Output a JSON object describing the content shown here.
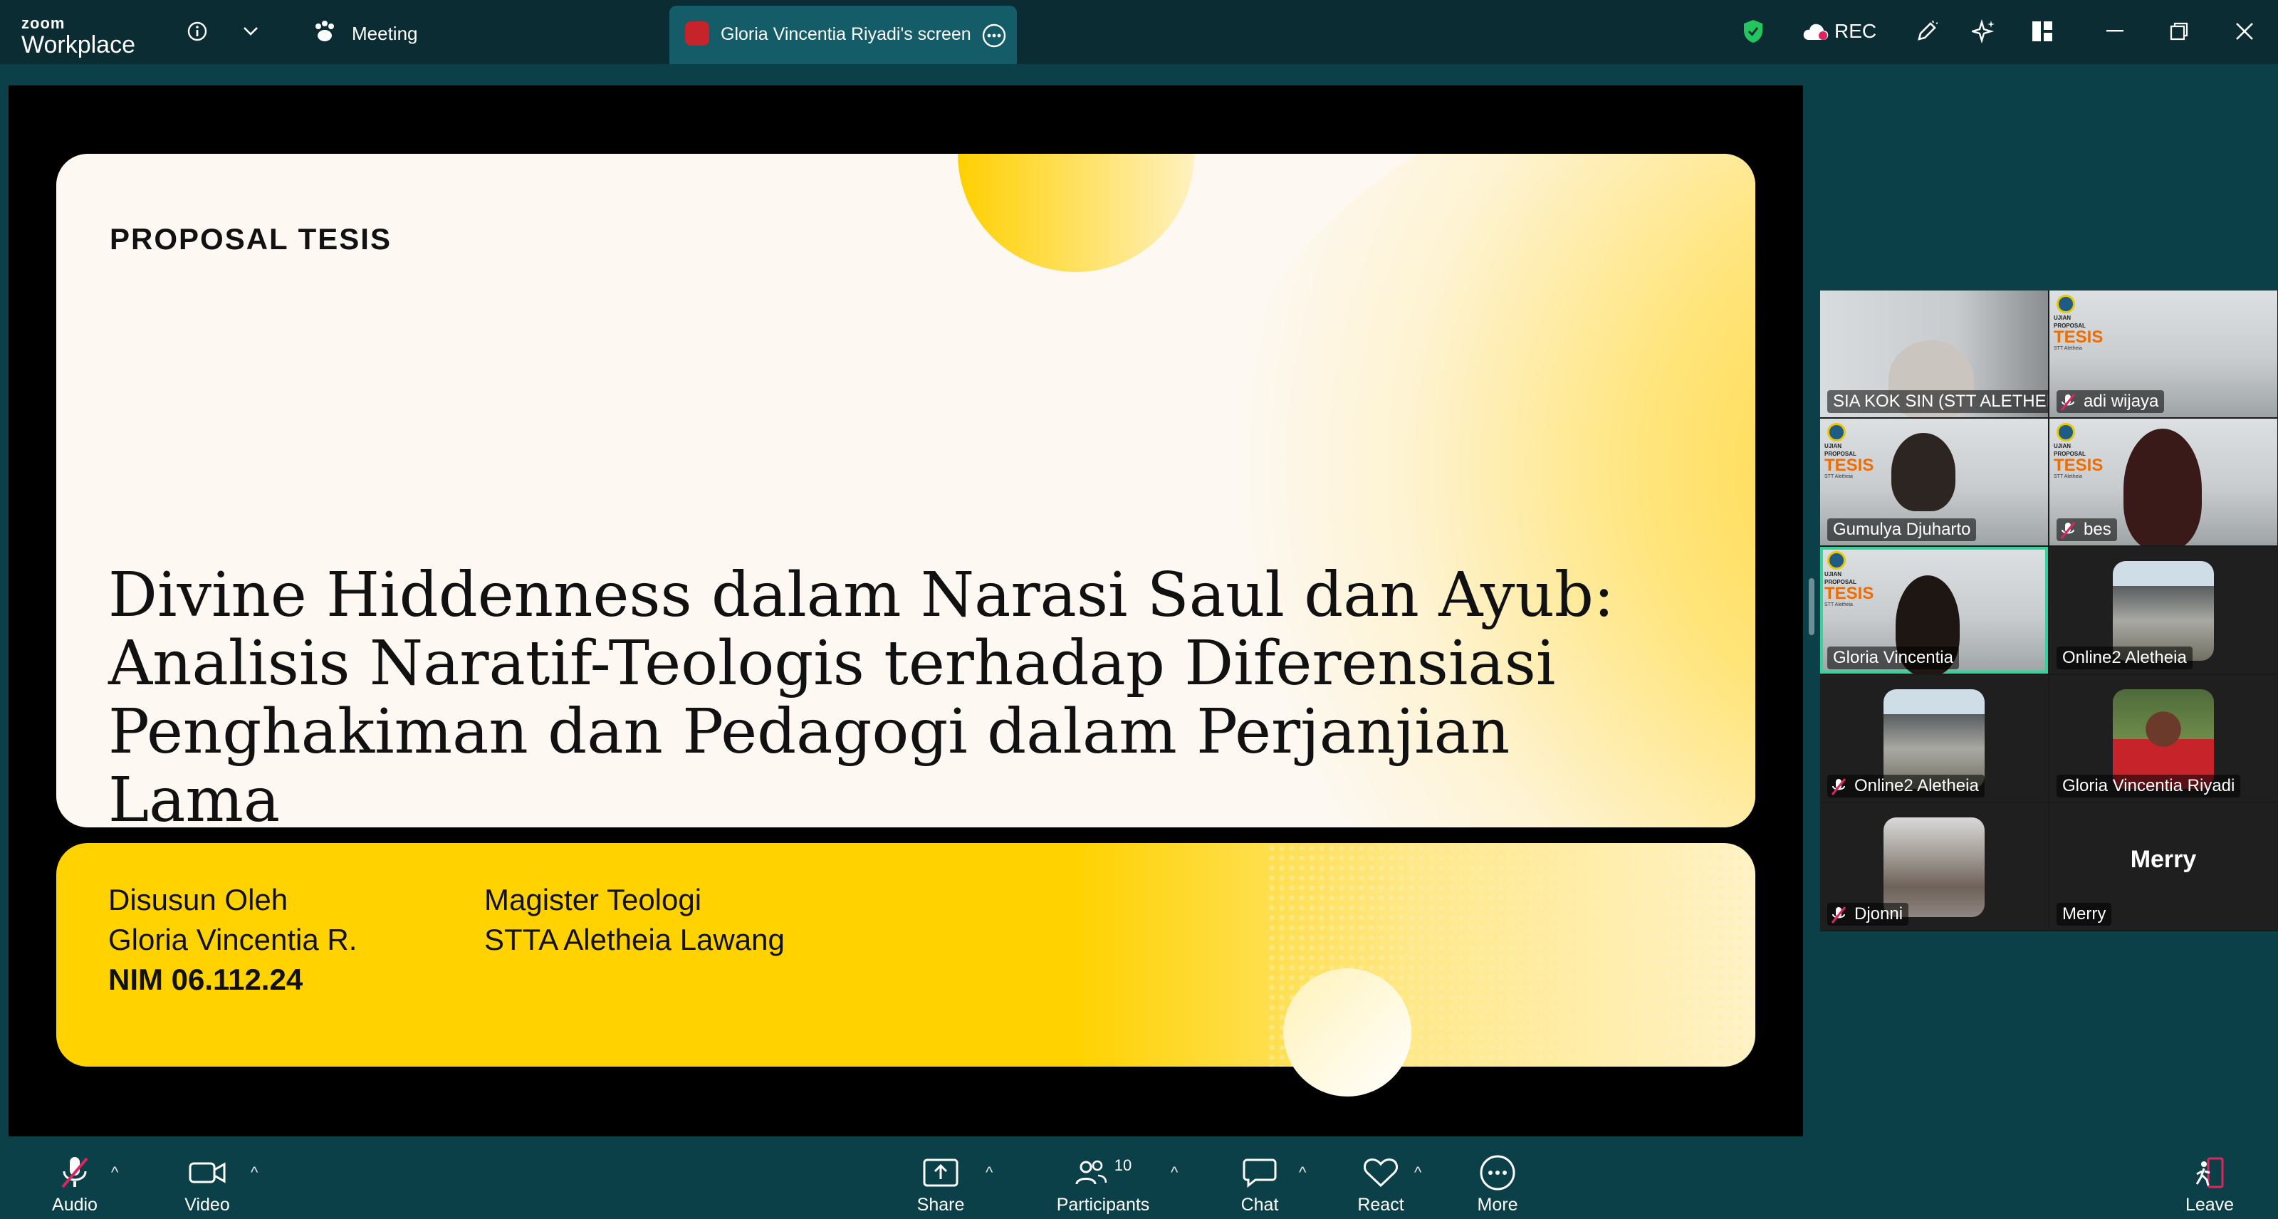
{
  "app": {
    "brand_top": "zoom",
    "brand_bottom": "Workplace"
  },
  "topbar": {
    "meeting_label": "Meeting",
    "screen_tab": "Gloria Vincentia Riyadi's screen",
    "rec_label": "REC"
  },
  "slide": {
    "kicker": "PROPOSAL TESIS",
    "title_lines": [
      "Divine Hiddenness dalam Narasi Saul dan Ayub:",
      "Analisis Naratif-Teologis terhadap Diferensiasi",
      "Penghakiman dan Pedagogi dalam Perjanjian Lama"
    ],
    "left_info": [
      "Disusun Oleh",
      "Gloria Vincentia R.",
      "NIM 06.112.24"
    ],
    "right_info": [
      "Magister Teologi",
      "STTA Aletheia Lawang"
    ]
  },
  "gallery": {
    "badge": {
      "line1": "UJIAN",
      "line2": "PROPOSAL",
      "line3": "TESIS",
      "line4": "STT Aletheia"
    },
    "tiles": [
      {
        "name": "SIA KOK SIN (STT ALETHEIA)",
        "muted": false
      },
      {
        "name": "adi wijaya",
        "muted": true
      },
      {
        "name": "Gumulya Djuharto",
        "muted": false
      },
      {
        "name": "bes",
        "muted": true
      },
      {
        "name": "Gloria Vincentia",
        "muted": false
      },
      {
        "name": "Online2 Aletheia",
        "muted": false
      },
      {
        "name": "Online2 Aletheia",
        "muted": true
      },
      {
        "name": "Gloria Vincentia Riyadi",
        "muted": false
      },
      {
        "name": "Djonni",
        "muted": true
      },
      {
        "name": "Merry",
        "muted": false,
        "display_name": "Merry"
      }
    ]
  },
  "toolbar": {
    "audio": "Audio",
    "video": "Video",
    "share": "Share",
    "participants": "Participants",
    "participants_count": "10",
    "chat": "Chat",
    "react": "React",
    "more": "More",
    "leave": "Leave"
  },
  "colors": {
    "accent_yellow": "#FFD200",
    "active_speaker": "#34D399",
    "leave": "#E0245E",
    "shield": "#22C55E"
  }
}
